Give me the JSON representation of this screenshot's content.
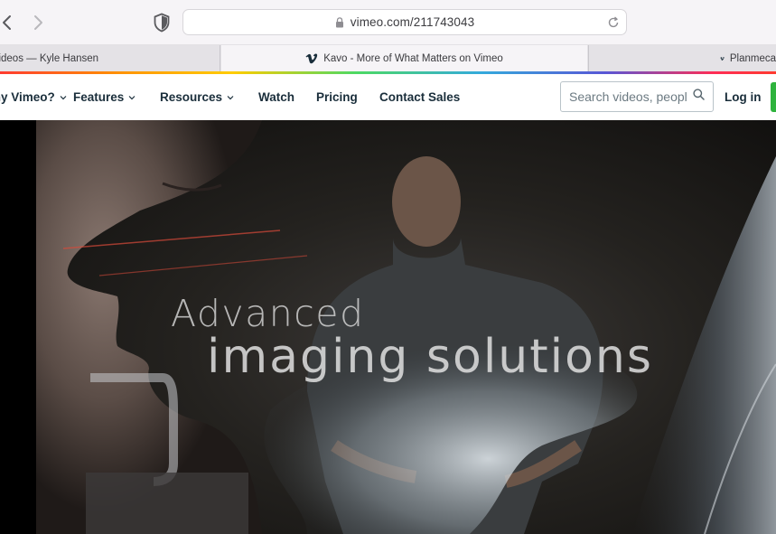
{
  "browser": {
    "url": "vimeo.com/211743043",
    "tabs": [
      {
        "title": "Videos — Kyle Hansen",
        "active": false
      },
      {
        "title": "Kavo - More of What Matters on Vimeo",
        "active": true
      },
      {
        "title": "Planmeca",
        "active": false
      }
    ],
    "icons": [
      "back-icon",
      "forward-icon",
      "shield-icon",
      "lock-icon",
      "reload-icon",
      "vimeo-favicon"
    ]
  },
  "header": {
    "nav": [
      {
        "label": "Why Vimeo?",
        "dropdown": true
      },
      {
        "label": "Features",
        "dropdown": true
      },
      {
        "label": "Resources",
        "dropdown": true
      },
      {
        "label": "Watch",
        "dropdown": false
      },
      {
        "label": "Pricing",
        "dropdown": false
      },
      {
        "label": "Contact Sales",
        "dropdown": false
      }
    ],
    "search_placeholder": "Search videos, people, and more",
    "login_label": "Log in",
    "join_color": "#2eb33d"
  },
  "video": {
    "headline_line1": "Advanced",
    "headline_line2": "imaging solutions"
  },
  "colors": {
    "nav_text": "#1a2e3b",
    "accent_green": "#2eb33d"
  }
}
